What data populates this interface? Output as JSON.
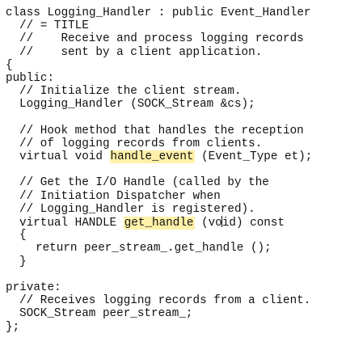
{
  "editor": {
    "lines": [
      {
        "indent": 0,
        "text": "class Logging_Handler : public Event_Handler"
      },
      {
        "indent": 1,
        "text": "// = TITLE"
      },
      {
        "indent": 1,
        "text": "//    Receive and process logging records"
      },
      {
        "indent": 1,
        "text": "//    sent by a client application."
      },
      {
        "indent": 0,
        "text": "{"
      },
      {
        "indent": 0,
        "text": "public:"
      },
      {
        "indent": 1,
        "text": "// Initialize the client stream."
      },
      {
        "indent": 1,
        "text": "Logging_Handler (SOCK_Stream &cs);"
      },
      {
        "indent": 1,
        "text": ""
      },
      {
        "indent": 1,
        "text": "// Hook method that handles the reception"
      },
      {
        "indent": 1,
        "text": "// of logging records from clients."
      },
      {
        "indent": 1,
        "pre": "virtual void ",
        "highlight": "handle_event",
        "post": " (Event_Type et);"
      },
      {
        "indent": 1,
        "text": ""
      },
      {
        "indent": 1,
        "text": "// Get the I/O Handle (called by the"
      },
      {
        "indent": 1,
        "text": "// Initiation Dispatcher when"
      },
      {
        "indent": 1,
        "text": "// Logging_Handler is registered)."
      },
      {
        "indent": 1,
        "pre": "virtual HANDLE ",
        "highlight": "get_handle",
        "post": " (vo",
        "cursor": true,
        "post2": "id) const"
      },
      {
        "indent": 1,
        "text": "{"
      },
      {
        "indent": 2,
        "text": "return peer_stream_.get_handle ();"
      },
      {
        "indent": 1,
        "text": "}"
      },
      {
        "indent": 0,
        "text": ""
      },
      {
        "indent": 0,
        "text": "private:"
      },
      {
        "indent": 1,
        "text": "// Receives logging records from a client."
      },
      {
        "indent": 1,
        "text": "SOCK_Stream peer_stream_;"
      },
      {
        "indent": 0,
        "text": "};"
      }
    ],
    "highlight_color": "#fff1a8"
  }
}
